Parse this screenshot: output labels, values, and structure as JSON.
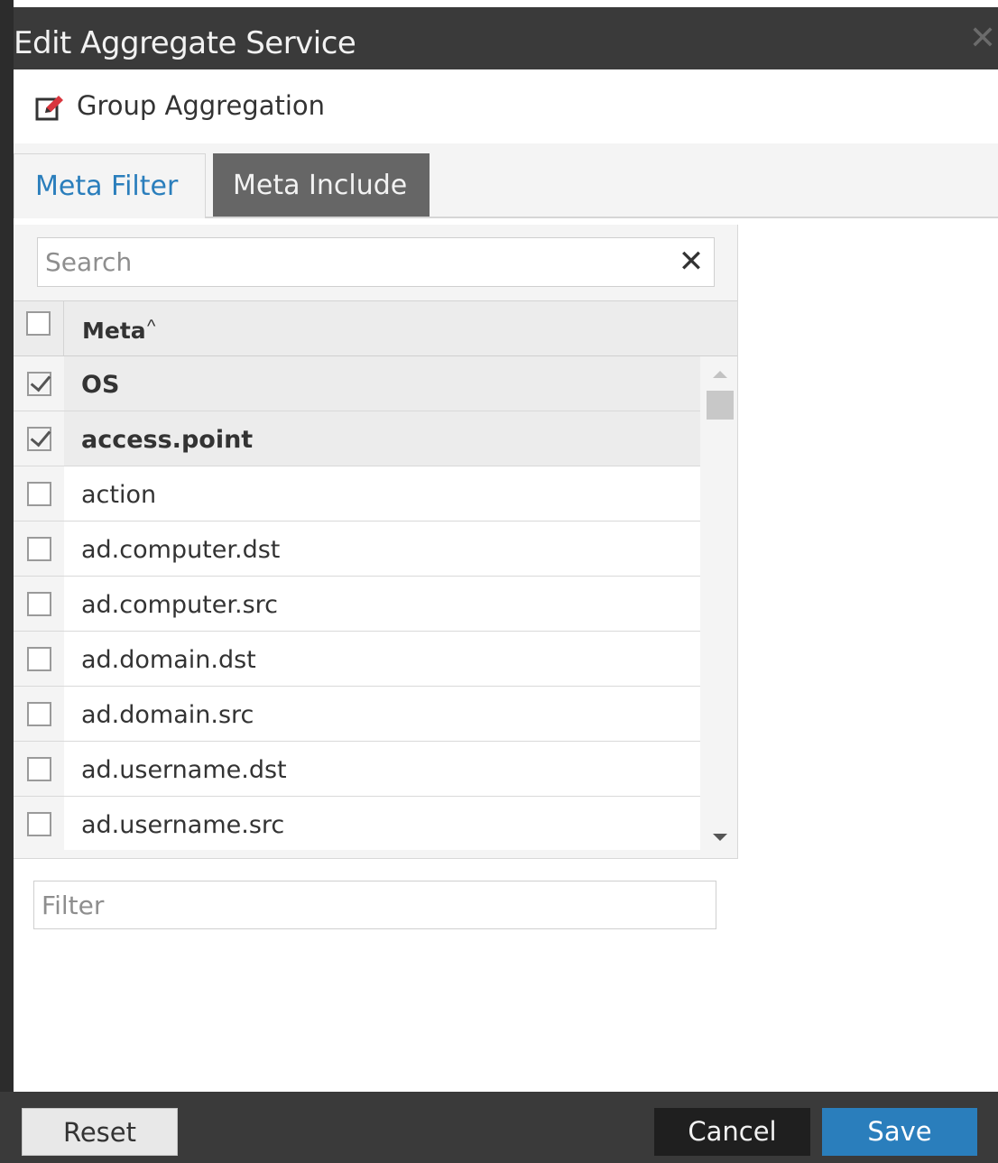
{
  "dialog": {
    "title": "Edit Aggregate Service",
    "close_glyph": "✕"
  },
  "header": {
    "icon": "edit-icon",
    "title": "Group Aggregation"
  },
  "tabs": [
    {
      "label": "Meta Filter",
      "active": true
    },
    {
      "label": "Meta Include",
      "active": false
    }
  ],
  "search": {
    "placeholder": "Search",
    "value": "",
    "clear_glyph": "✕"
  },
  "grid": {
    "column_header": "Meta",
    "sort_glyph": "^",
    "rows": [
      {
        "label": "OS",
        "checked": true
      },
      {
        "label": "access.point",
        "checked": true
      },
      {
        "label": "action",
        "checked": false
      },
      {
        "label": "ad.computer.dst",
        "checked": false
      },
      {
        "label": "ad.computer.src",
        "checked": false
      },
      {
        "label": "ad.domain.dst",
        "checked": false
      },
      {
        "label": "ad.domain.src",
        "checked": false
      },
      {
        "label": "ad.username.dst",
        "checked": false
      },
      {
        "label": "ad.username.src",
        "checked": false
      }
    ]
  },
  "filter": {
    "placeholder": "Filter",
    "value": ""
  },
  "footer": {
    "reset_label": "Reset",
    "cancel_label": "Cancel",
    "save_label": "Save"
  },
  "colors": {
    "accent": "#2a7ebc",
    "title_bar": "#3a3a3a",
    "inactive_tab": "#666666"
  }
}
